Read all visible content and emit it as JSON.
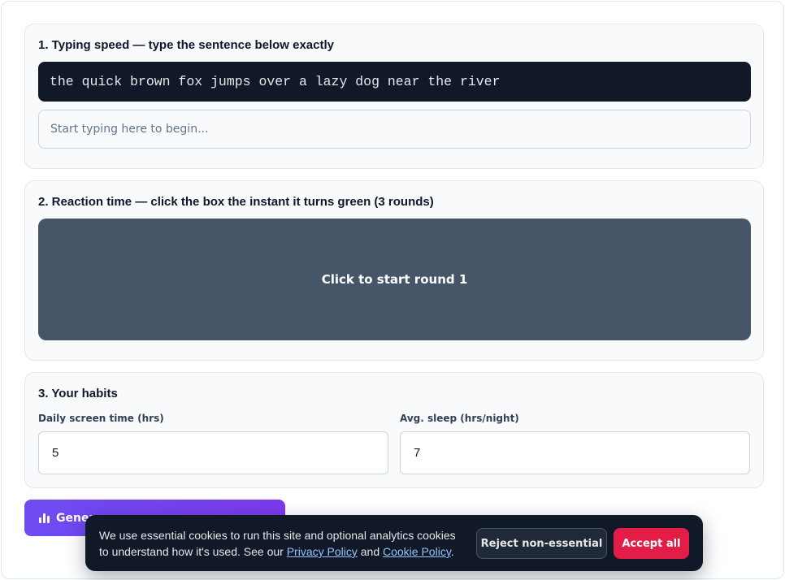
{
  "typing": {
    "heading": "1. Typing speed — type the sentence below exactly",
    "sentence": "the quick brown fox jumps over a lazy dog near the river",
    "input_placeholder": "Start typing here to begin...",
    "input_value": ""
  },
  "reaction": {
    "heading": "2. Reaction time — click the box the instant it turns green (3 rounds)",
    "box_label": "Click to start round 1",
    "box_color": "#475569"
  },
  "habits": {
    "heading": "3. Your habits",
    "screen_time_label": "Daily screen time (hrs)",
    "screen_time_value": "5",
    "sleep_label": "Avg. sleep (hrs/night)",
    "sleep_value": "7"
  },
  "generate_button": {
    "label": "Gener",
    "icon": "bar-chart-icon"
  },
  "cookie_banner": {
    "text_before": "We use essential cookies to run this site and optional analytics cookies to understand how it's used. See our ",
    "privacy_link": "Privacy Policy",
    "text_middle": " and ",
    "cookie_link": "Cookie Policy",
    "text_after": ".",
    "reject_label": "Reject non-essential",
    "accept_label": "Accept all"
  },
  "colors": {
    "accent": "#7c3aed",
    "accept": "#e11d48",
    "banner": "#111827",
    "sentence_bg": "#111827"
  }
}
